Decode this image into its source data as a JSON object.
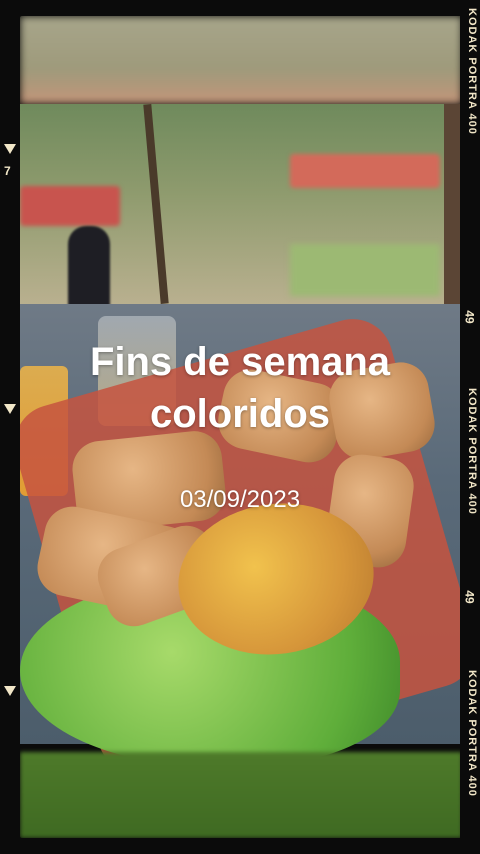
{
  "title_line1": "Fins de semana",
  "title_line2": "coloridos",
  "date": "03/09/2023",
  "film_brand_top": "KODAK PORTRA 400",
  "film_brand_mid": "KODAK PORTRA 400",
  "film_brand_bot": "KODAK PORTRA 400",
  "frame_num1": "49",
  "frame_num2": "49",
  "left_mark1": "7",
  "colors": {
    "text": "#ffffff",
    "film_text": "#f2e7c8",
    "frame": "#0b0b0b"
  }
}
